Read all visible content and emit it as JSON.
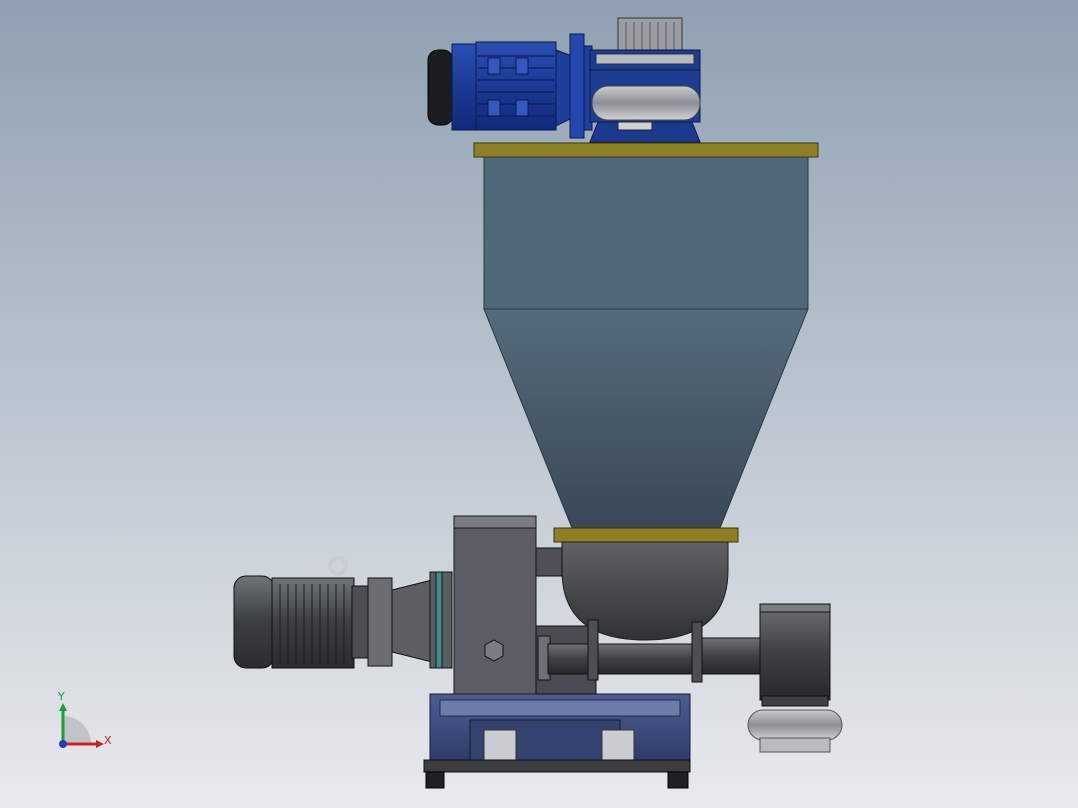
{
  "viewport": {
    "background_top": "#8fa0b2",
    "background_bottom": "#e8eaed"
  },
  "model": {
    "colors": {
      "motor_blue": "#1f3f99",
      "motor_blue_dark": "#132a6b",
      "hopper_steel": "#506677",
      "hopper_steel_dark": "#3f5463",
      "flange_yellow": "#9a8a1e",
      "motor_grey": "#3d4246",
      "housing_grey": "#5b5d66",
      "pipe_grey": "#4a4d52",
      "base_blue": "#3b4a7a",
      "outline": "#1a1a1a"
    }
  },
  "triad": {
    "x_label": "X",
    "y_label": "Y",
    "x_color": "#d22020",
    "y_color": "#1aa32a",
    "z_color": "#1f3fbf"
  }
}
